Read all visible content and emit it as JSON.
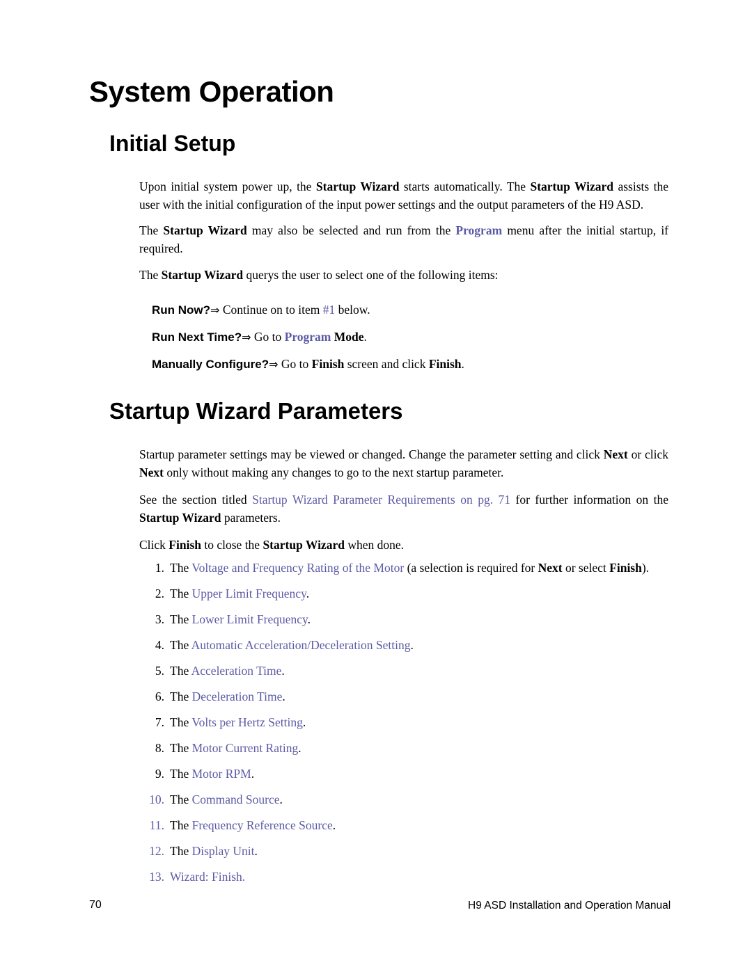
{
  "document": {
    "chapter_title": "System Operation",
    "section_1_title": "Initial Setup",
    "section_2_title": "Startup Wizard Parameters"
  },
  "paragraphs": {
    "p1_a": "Upon initial system power up, the ",
    "p1_b1": "Startup Wizard",
    "p1_c": " starts automatically. The ",
    "p1_b2": "Startup Wizard",
    "p1_d": " assists the user with the initial configuration of the input power settings and the output parameters of the H9 ASD.",
    "p2_a": "The ",
    "p2_b1": "Startup Wizard",
    "p2_c": " may also be selected and run from the ",
    "p2_link": "Program",
    "p2_d": " menu after the initial startup, if required.",
    "p3_a": "The ",
    "p3_b1": "Startup Wizard",
    "p3_c": " querys the user to select one of the following items:",
    "p4_a": "Startup parameter settings may be viewed or changed. Change the parameter setting and click ",
    "p4_b1": "Next",
    "p4_c": " or click ",
    "p4_b2": "Next",
    "p4_d": " only without making any changes to go to the next startup parameter.",
    "p5_a": "See the section titled ",
    "p5_link": "Startup Wizard Parameter Requirements on pg. 71",
    "p5_b": " for further information on the ",
    "p5_bold": "Startup Wizard",
    "p5_c": " parameters.",
    "p6_a": "Click ",
    "p6_b1": "Finish",
    "p6_c": " to close the ",
    "p6_b2": "Startup Wizard",
    "p6_d": " when done."
  },
  "queries": [
    {
      "label": "Run Now?",
      "arrow": "⇒",
      "text_a": " Continue on to item ",
      "link": "#1",
      "text_b": " below."
    },
    {
      "label": "Run Next Time?",
      "arrow": "⇒",
      "text_a": " Go to ",
      "link": "Program",
      "text_b": " ",
      "bold": "Mode",
      "text_c": "."
    },
    {
      "label": "Manually Configure?",
      "arrow": "⇒",
      "text_a": " Go to ",
      "bold1": "Finish",
      "text_b": " screen and click ",
      "bold2": "Finish",
      "text_c": "."
    }
  ],
  "numbered_list": [
    {
      "num": "1.",
      "prefix": "The ",
      "link": "Voltage and Frequency Rating of the Motor",
      "mid": " (a selection is required for ",
      "bold1": "Next",
      "mid2": " or select ",
      "bold2": "Finish",
      "suffix": ")."
    },
    {
      "num": "2.",
      "prefix": "The ",
      "link": "Upper Limit Frequency",
      "suffix": "."
    },
    {
      "num": "3.",
      "prefix": "The ",
      "link": "Lower Limit Frequency",
      "suffix": "."
    },
    {
      "num": "4.",
      "prefix": "The ",
      "link": "Automatic Acceleration/Deceleration Setting",
      "suffix": "."
    },
    {
      "num": "5.",
      "prefix": "The ",
      "link": "Acceleration Time",
      "suffix": "."
    },
    {
      "num": "6.",
      "prefix": "The ",
      "link": "Deceleration Time",
      "suffix": "."
    },
    {
      "num": "7.",
      "prefix": "The ",
      "link": "Volts per Hertz Setting",
      "suffix": "."
    },
    {
      "num": "8.",
      "prefix": "The ",
      "link": "Motor Current Rating",
      "suffix": "."
    },
    {
      "num": "9.",
      "prefix": "The ",
      "link": "Motor RPM",
      "suffix": "."
    },
    {
      "num": "10.",
      "prefix": "The ",
      "link": "Command Source",
      "suffix": "."
    },
    {
      "num": "11.",
      "prefix": "The ",
      "link": "Frequency Reference Source",
      "suffix": "."
    },
    {
      "num": "12.",
      "prefix": "The ",
      "link": "Display Unit",
      "suffix": "."
    },
    {
      "num": "13.",
      "prefix": "",
      "link": "Wizard: Finish",
      "suffix": "."
    }
  ],
  "footer": {
    "page_number": "70",
    "manual_title": "H9 ASD Installation and Operation Manual"
  },
  "colors": {
    "link": "#5B5BA5",
    "text": "#000000",
    "background": "#FFFFFF"
  }
}
